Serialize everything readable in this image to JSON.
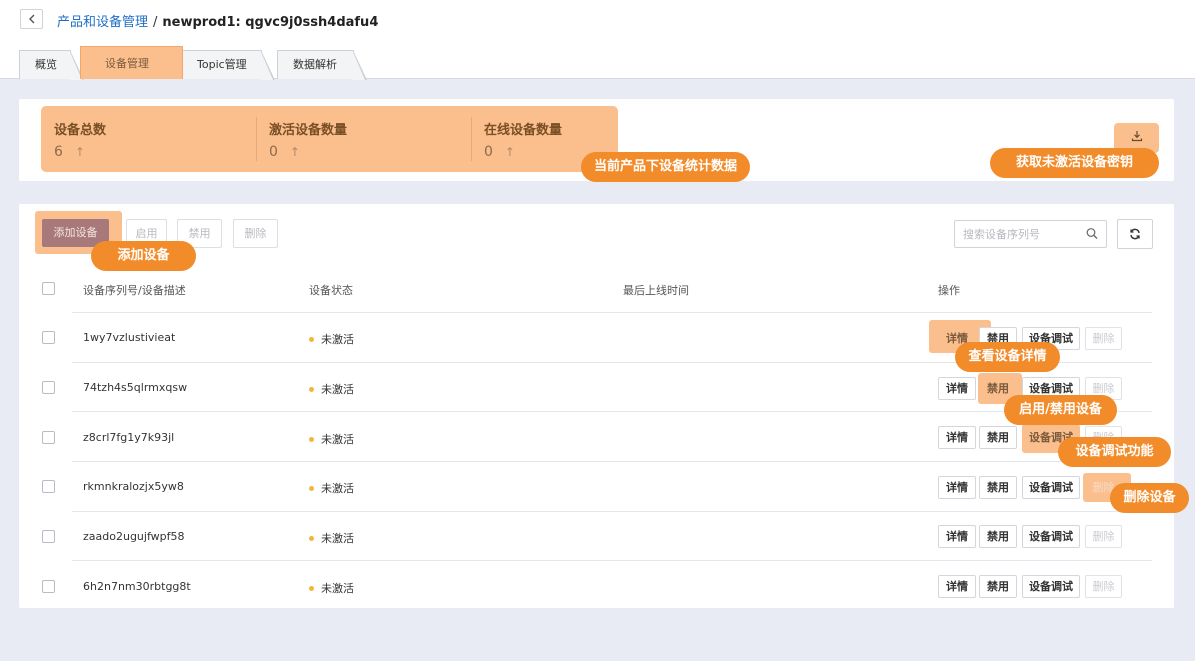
{
  "breadcrumb": {
    "back_icon": "chevron-left-icon",
    "parent": "产品和设备管理",
    "separator": "/",
    "current": "newprod1: qgvc9j0ssh4dafu4"
  },
  "tabs": [
    {
      "label": "概览"
    },
    {
      "label": "设备管理",
      "active": true
    },
    {
      "label": "Topic管理"
    },
    {
      "label": "数据解析"
    }
  ],
  "stats": [
    {
      "title": "设备总数",
      "value": "6"
    },
    {
      "title": "激活设备数量",
      "value": "0"
    },
    {
      "title": "在线设备数量",
      "value": "0"
    }
  ],
  "stats_arrow": "↑",
  "download_icon": "download-icon",
  "callouts": {
    "stats": "当前产品下设备统计数据",
    "secret": "获取未激活设备密钥",
    "add": "添加设备",
    "detail": "查看设备详情",
    "enable_disable": "启用/禁用设备",
    "debug": "设备调试功能",
    "delete": "删除设备"
  },
  "toolbar": {
    "add_label": "添加设备",
    "enable_label": "启用",
    "disable_label": "禁用",
    "delete_label": "删除"
  },
  "search": {
    "placeholder": "搜索设备序列号",
    "value": ""
  },
  "table": {
    "headers": {
      "serial": "设备序列号/设备描述",
      "status": "设备状态",
      "last_online": "最后上线时间",
      "actions": "操作"
    },
    "rows": [
      {
        "serial": "1wy7vzlustivieat",
        "status": "未激活",
        "last_online": ""
      },
      {
        "serial": "74tzh4s5qlrmxqsw",
        "status": "未激活",
        "last_online": ""
      },
      {
        "serial": "z8crl7fg1y7k93jl",
        "status": "未激活",
        "last_online": ""
      },
      {
        "serial": "rkmnkralozjx5yw8",
        "status": "未激活",
        "last_online": ""
      },
      {
        "serial": "zaado2ugujfwpf58",
        "status": "未激活",
        "last_online": ""
      },
      {
        "serial": "6h2n7nm30rbtgg8t",
        "status": "未激活",
        "last_online": ""
      }
    ],
    "row_actions": {
      "detail": "详情",
      "disable": "禁用",
      "debug": "设备调试",
      "delete": "删除"
    }
  },
  "colors": {
    "accent": "#f28b2a",
    "highlight": "#fbbf8e",
    "link": "#1f6fc6",
    "status_dot": "#f2b735"
  }
}
